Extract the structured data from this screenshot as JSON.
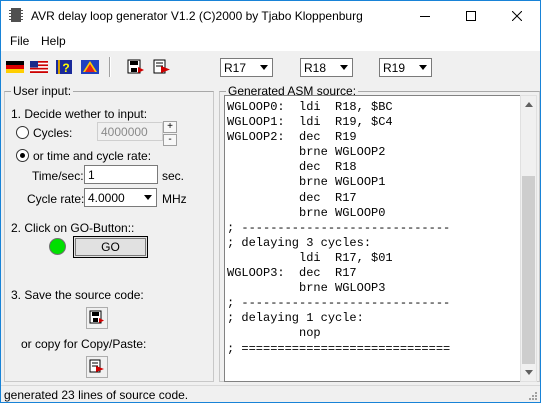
{
  "window": {
    "title": "AVR delay loop generator  V1.2 (C)2000 by Tjabo Kloppenburg"
  },
  "menu": [
    {
      "label": "File"
    },
    {
      "label": "Help"
    }
  ],
  "toolbar": {
    "language_buttons": [
      "german-flag-icon",
      "us-flag-icon",
      "help-book-icon",
      "hazard-icon"
    ],
    "action_buttons": [
      "save-disk-icon",
      "copy-arrow-icon"
    ],
    "registers": [
      {
        "value": "R17"
      },
      {
        "value": "R18"
      },
      {
        "value": "R19"
      }
    ]
  },
  "user_input": {
    "group_label": "User input:",
    "step1_label": "1. Decide wether to input:",
    "cycles_label": "Cycles:",
    "cycles_value": "4000000",
    "spin_up": "+",
    "spin_down": "-",
    "time_option_label": "or time and cycle rate:",
    "time_label": "Time/sec:",
    "time_value": "1",
    "time_unit": "sec.",
    "rate_label": "Cycle rate:",
    "rate_value": "4.0000",
    "rate_unit": "MHz",
    "selected_option": "time",
    "step2_label": "2. Click on GO-Button::",
    "go_label": "GO",
    "led_color": "#00e000",
    "step3_label": "3. Save the source code:",
    "copy_label": "or copy for Copy/Paste:"
  },
  "asm": {
    "group_label": "Generated ASM source:",
    "lines": [
      "WGLOOP0:  ldi  R18, $BC",
      "WGLOOP1:  ldi  R19, $C4",
      "WGLOOP2:  dec  R19",
      "          brne WGLOOP2",
      "          dec  R18",
      "          brne WGLOOP1",
      "          dec  R17",
      "          brne WGLOOP0",
      "; -----------------------------",
      "; delaying 3 cycles:",
      "          ldi  R17, $01",
      "WGLOOP3:  dec  R17",
      "          brne WGLOOP3",
      "; -----------------------------",
      "; delaying 1 cycle:",
      "          nop",
      "; ============================="
    ]
  },
  "status": {
    "text": "generated 23 lines of source code."
  }
}
